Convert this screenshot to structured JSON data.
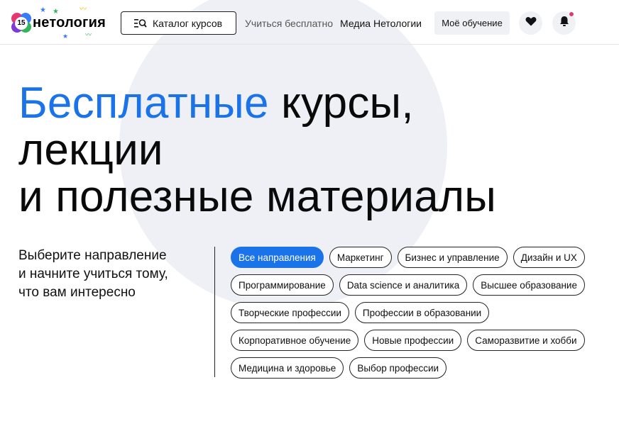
{
  "header": {
    "logo": {
      "brand": "нетология",
      "badge": "15"
    },
    "catalog_label": "Каталог курсов",
    "nav_free": "Учиться бесплатно",
    "nav_media": "Медиа Нетологии",
    "my_learning": "Моё обучение",
    "icons": [
      "search-list-icon",
      "heart-icon",
      "bell-icon"
    ]
  },
  "hero": {
    "accent": "Бесплатные",
    "line1_rest": " курсы,",
    "line2": "лекции",
    "line3": "и полезные материалы"
  },
  "subtitle": {
    "line1": "Выберите направление",
    "line2": "и начните учиться тому,",
    "line3": "что вам интересно"
  },
  "directions": [
    {
      "label": "Все направления",
      "active": true
    },
    {
      "label": "Маркетинг",
      "active": false
    },
    {
      "label": "Бизнес и управление",
      "active": false
    },
    {
      "label": "Дизайн и UX",
      "active": false
    },
    {
      "label": "Программирование",
      "active": false
    },
    {
      "label": "Data science и аналитика",
      "active": false
    },
    {
      "label": "Высшее образование",
      "active": false
    },
    {
      "label": "Творческие профессии",
      "active": false
    },
    {
      "label": "Профессии в образовании",
      "active": false
    },
    {
      "label": "Корпоративное обучение",
      "active": false
    },
    {
      "label": "Новые профессии",
      "active": false
    },
    {
      "label": "Саморазвитие и хобби",
      "active": false
    },
    {
      "label": "Медицина и здоровье",
      "active": false
    },
    {
      "label": "Выбор профессии",
      "active": false
    }
  ],
  "colors": {
    "accent": "#1a73e8",
    "notification": "#e5386e",
    "hero_circle": "#eef0f6"
  }
}
